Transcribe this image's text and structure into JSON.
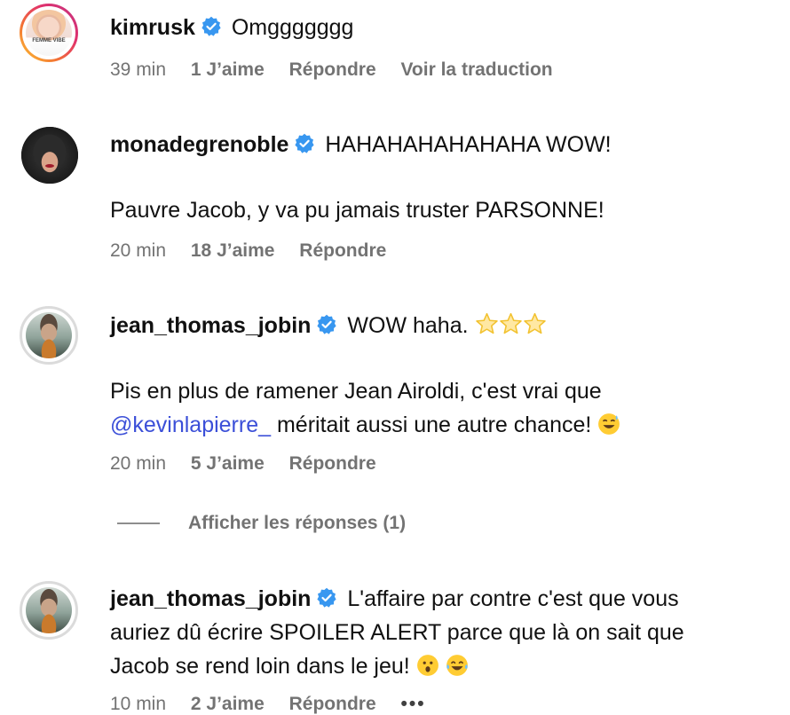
{
  "comments": [
    {
      "username": "kimrusk",
      "text_lines": [
        "Omggggggg"
      ],
      "time": "39 min",
      "likes": "1 J’aime",
      "reply": "Répondre",
      "translate": "Voir la traduction"
    },
    {
      "username": "monadegrenoble",
      "text_lines": [
        "HAHAHAHAHAHAHA WOW!",
        "Pauvre Jacob, y va pu jamais truster PARSONNE!"
      ],
      "time": "20 min",
      "likes": "18 J’aime",
      "reply": "Répondre"
    },
    {
      "username": "jean_thomas_jobin",
      "text_first": "WOW haha.",
      "text_line2": "Pis en plus de ramener Jean Airoldi, c'est vrai que",
      "mention": "@kevinlapierre_",
      "text_line3_rest": "méritait aussi une autre chance!",
      "time": "20 min",
      "likes": "5 J’aime",
      "reply": "Répondre"
    },
    {
      "username": "jean_thomas_jobin",
      "text_lines": [
        "L'affaire par contre c'est que vous",
        "auriez dû écrire SPOILER ALERT parce que là on sait que",
        "Jacob se rend loin dans le jeu!"
      ],
      "time": "10 min",
      "likes": "2 J’aime",
      "reply": "Répondre",
      "more": "•••"
    }
  ],
  "replies_toggle": "Afficher les réponses (1)",
  "colors": {
    "verified": "#3897f0",
    "mention": "#3b4fd8",
    "meta": "#737373"
  },
  "icons": [
    "verified-badge-icon",
    "star-emoji",
    "sweat-smile-emoji",
    "surprised-emoji",
    "tears-of-joy-emoji",
    "more-options-icon"
  ]
}
